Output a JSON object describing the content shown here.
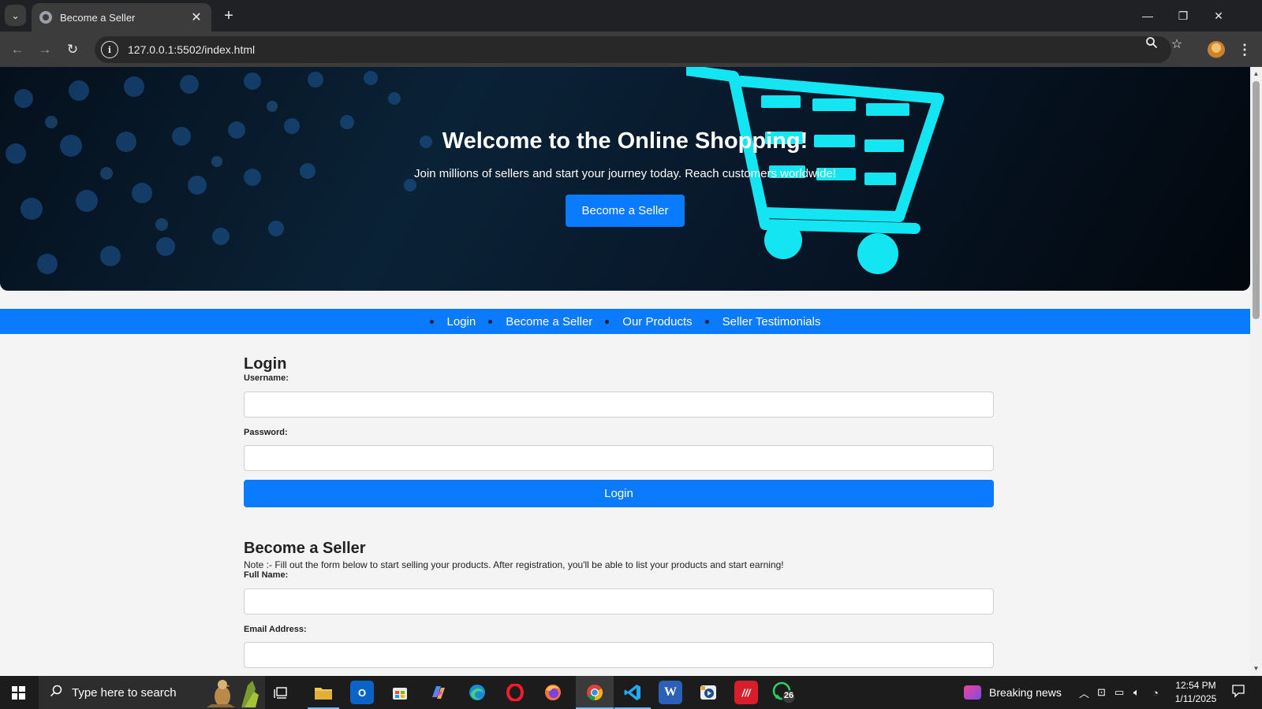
{
  "browser": {
    "tab_title": "Become a Seller",
    "tab_close": "✕",
    "new_tab": "+",
    "url": "127.0.0.1:5502/index.html",
    "window_minimize": "—",
    "window_restore": "❐",
    "window_close": "✕"
  },
  "hero": {
    "title": "Welcome to the Online Shopping!",
    "subtitle": "Join millions of sellers and start your journey today. Reach customers worldwide!",
    "button": "Become a Seller"
  },
  "nav": {
    "items": [
      "Login",
      "Become a Seller",
      "Our Products",
      "Seller Testimonials"
    ]
  },
  "login": {
    "title": "Login",
    "username_label": "Username:",
    "username_value": "",
    "password_label": "Password:",
    "password_value": "",
    "submit": "Login"
  },
  "seller": {
    "title": "Become a Seller",
    "note": "Note :- Fill out the form below to start selling your products. After registration, you'll be able to list your products and start earning!",
    "fullname_label": "Full Name:",
    "fullname_value": "",
    "email_label": "Email Address:",
    "email_value": ""
  },
  "taskbar": {
    "search_placeholder": "Type here to search",
    "whatsapp_badge": "26",
    "news": "Breaking news",
    "time": "12:54 PM",
    "date": "1/11/2025"
  },
  "colors": {
    "accent": "#0a7bff",
    "page_bg": "#f4f4f4",
    "chrome_dark": "#202124",
    "chrome_toolbar": "#3c3c3c",
    "cart_glow": "#13e6f2"
  }
}
